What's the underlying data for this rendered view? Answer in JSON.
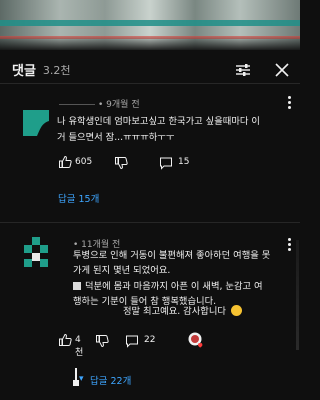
{
  "header": {
    "title": "댓글",
    "count": "3.2천"
  },
  "comments": [
    {
      "time": "• 9개월 전",
      "lines": [
        "나 유학생인데 엄마보고싶고 한국가고 싶을때마다 이",
        "거 들으면서 잠...ㅠㅠㅠ하ㅜㅜ"
      ],
      "likes": "605",
      "replies_inline": "15",
      "replies_link": "답글 15개"
    },
    {
      "time": "• 11개월 전",
      "lines": [
        "투병으로 인해 거동이 불편해져 좋아하던 여행을 못",
        "가게 된지 몇년 되었어요.",
        "덕분에 몸과 마음까지 아픈 이 새벽, 눈감고 여",
        "행하는 기분이 들어 참 행복했습니다.",
        "정말 최고예요. 감사합니다"
      ],
      "likes": "4천",
      "replies_inline": "22",
      "replies_link": "답글 22개"
    }
  ],
  "colors": {
    "background": "#0f0f0f",
    "link": "#3ea6ff",
    "avatar_teal": "#1f9e8a"
  }
}
